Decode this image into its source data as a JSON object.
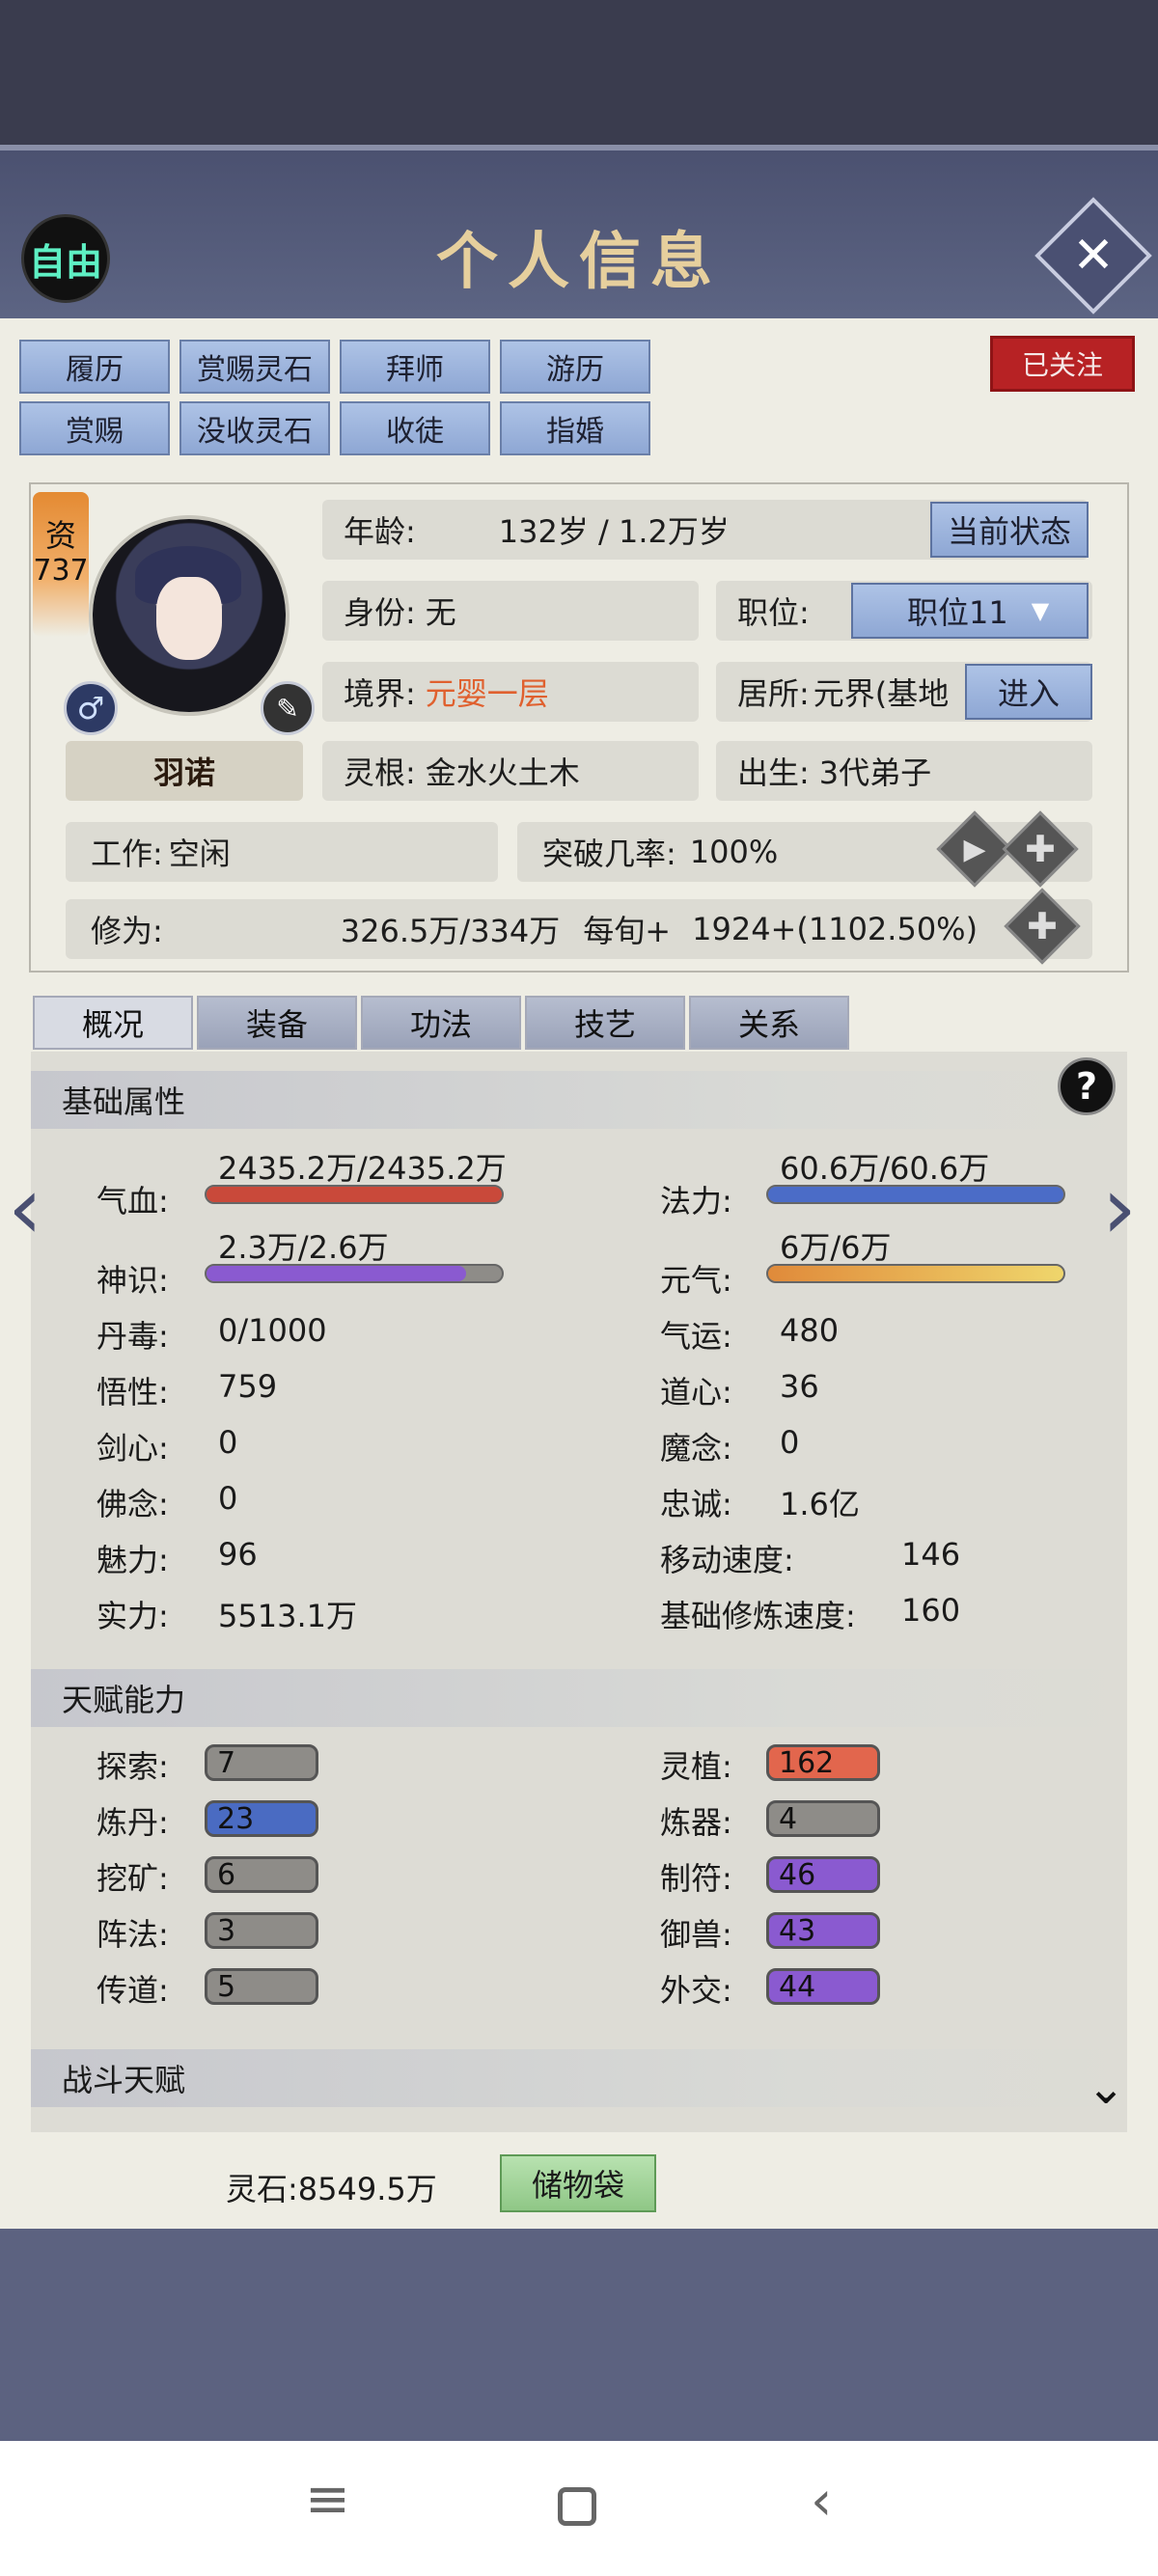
{
  "header": {
    "free_label": "自由",
    "title": "个人信息",
    "close_icon": "close-icon"
  },
  "actions": {
    "row1": [
      "履历",
      "赏赐灵石",
      "拜师",
      "游历"
    ],
    "row2": [
      "赏赐",
      "没收灵石",
      "收徒",
      "指婚"
    ],
    "followed": "已关注"
  },
  "profile": {
    "zi_label": "资",
    "zi_value": "737",
    "name": "羽诺",
    "age_label": "年龄:",
    "age_value": "132岁 / 1.2万岁",
    "current_status_btn": "当前状态",
    "identity_label": "身份:",
    "identity_value": "无",
    "position_label": "职位:",
    "position_value": "职位11",
    "realm_label": "境界:",
    "realm_value": "元婴一层",
    "residence_label": "居所:",
    "residence_value": "元界(基地",
    "enter_btn": "进入",
    "root_label": "灵根:",
    "root_value": "金水火土木",
    "birth_label": "出生:",
    "birth_value": "3代弟子",
    "work_label": "工作:",
    "work_value": "空闲",
    "breakthrough_label": "突破几率:",
    "breakthrough_value": "100%",
    "cultivation_label": "修为:",
    "cultivation_value": "326.5万/334万",
    "per_period_label": "每旬+",
    "per_period_value": "1924+(1102.50%)"
  },
  "tabs": [
    "概况",
    "装备",
    "功法",
    "技艺",
    "关系"
  ],
  "basic": {
    "title": "基础属性",
    "qixue": {
      "label": "气血:",
      "value": "2435.2万/2435.2万",
      "fill": 1.0,
      "color": "#c9493a"
    },
    "fali": {
      "label": "法力:",
      "value": "60.6万/60.6万",
      "fill": 1.0,
      "color": "#4b6cc7"
    },
    "shenshi": {
      "label": "神识:",
      "value": "2.3万/2.6万",
      "fill": 0.88,
      "color": "#8a5ad0"
    },
    "yuanqi": {
      "label": "元气:",
      "value": "6万/6万",
      "fill": 1.0,
      "color": "#e09a3c"
    },
    "left": [
      {
        "label": "丹毒:",
        "value": "0/1000"
      },
      {
        "label": "悟性:",
        "value": "759"
      },
      {
        "label": "剑心:",
        "value": "0"
      },
      {
        "label": "佛念:",
        "value": "0"
      },
      {
        "label": "魅力:",
        "value": "96"
      },
      {
        "label": "实力:",
        "value": "5513.1万"
      }
    ],
    "right": [
      {
        "label": "气运:",
        "value": "480"
      },
      {
        "label": "道心:",
        "value": "36"
      },
      {
        "label": "魔念:",
        "value": "0"
      },
      {
        "label": "忠诚:",
        "value": "1.6亿"
      },
      {
        "label": "移动速度:",
        "value": "146"
      },
      {
        "label": "基础修炼速度:",
        "value": "160"
      }
    ]
  },
  "talent": {
    "title": "天赋能力",
    "left": [
      {
        "label": "探索:",
        "value": "7",
        "color": "#8e8c88"
      },
      {
        "label": "炼丹:",
        "value": "23",
        "color": "#4a6bc2"
      },
      {
        "label": "挖矿:",
        "value": "6",
        "color": "#8e8c88"
      },
      {
        "label": "阵法:",
        "value": "3",
        "color": "#8e8c88"
      },
      {
        "label": "传道:",
        "value": "5",
        "color": "#8e8c88"
      }
    ],
    "right": [
      {
        "label": "灵植:",
        "value": "162",
        "color": "#e2664d"
      },
      {
        "label": "炼器:",
        "value": "4",
        "color": "#8e8c88"
      },
      {
        "label": "制符:",
        "value": "46",
        "color": "#8a5ad0"
      },
      {
        "label": "御兽:",
        "value": "43",
        "color": "#8a5ad0"
      },
      {
        "label": "外交:",
        "value": "44",
        "color": "#8a5ad0"
      }
    ]
  },
  "combat": {
    "title": "战斗天赋"
  },
  "bottom": {
    "lingshi": "灵石:8549.5万",
    "bag": "储物袋"
  }
}
